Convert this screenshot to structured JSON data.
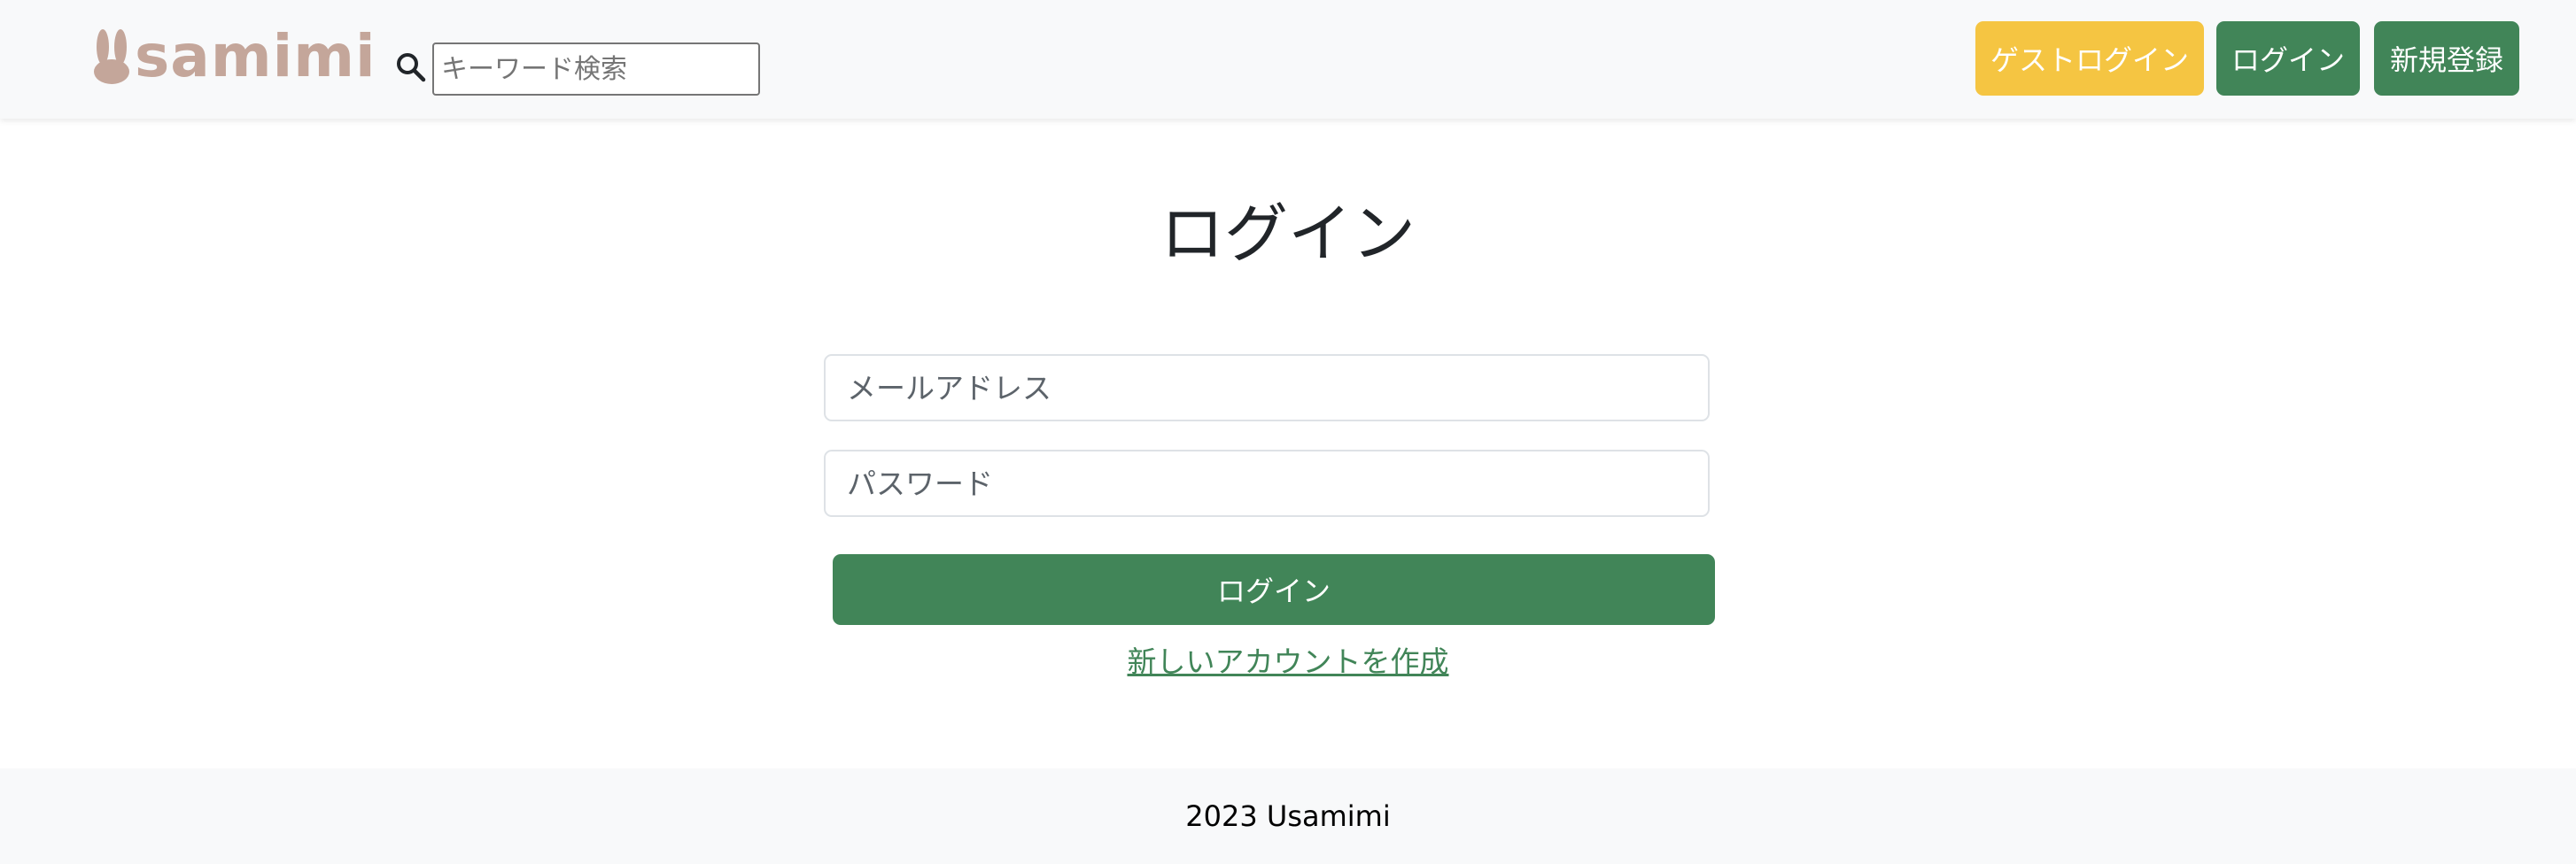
{
  "header": {
    "logo_text": "Usamimi",
    "logo_display": "samimi",
    "search_placeholder": "キーワード検索",
    "guest_login_label": "ゲストログイン",
    "login_label": "ログイン",
    "register_label": "新規登録"
  },
  "main": {
    "title": "ログイン",
    "email_placeholder": "メールアドレス",
    "password_placeholder": "パスワード",
    "submit_label": "ログイン",
    "signup_link_label": "新しいアカウントを作成"
  },
  "footer": {
    "text": "2023 Usamimi"
  },
  "colors": {
    "primary": "#418558",
    "guest": "#f5c542",
    "logo": "#c4a69a",
    "header_bg": "#f8f9fa"
  },
  "icons": {
    "logo": "bunny-icon",
    "search": "search-icon"
  }
}
